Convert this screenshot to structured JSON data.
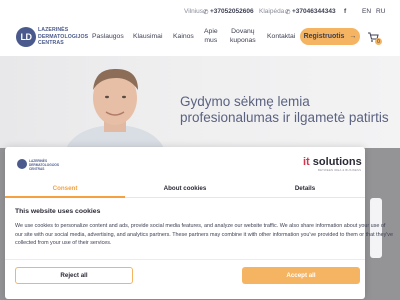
{
  "brand": {
    "logo_initials": "LD",
    "logo_text": "LAZERINĖS DERMATOLOGIJOS CENTRAS"
  },
  "topbar": {
    "city1": "Vilnius",
    "phone1": "+37052052606",
    "city2": "Klaipėda",
    "phone2": "+37046344343",
    "lang_en": "EN",
    "lang_ru": "RU"
  },
  "nav": {
    "services": "Paslaugos",
    "faq": "Klausimai",
    "prices": "Kainos",
    "about_line1": "Apie",
    "about_line2": "mus",
    "gift_line1": "Dovanų",
    "gift_line2": "kuponas",
    "contacts": "Kontaktai",
    "register": "Registruotis",
    "cart_count": "0"
  },
  "hero": {
    "title": "Gydymo sėkmę lemia profesionalumas ir ilgametė patirtis"
  },
  "cookie_dialog": {
    "brand_name": "solutions",
    "brand_prefix": "it",
    "brand_tagline": "BETWEEN IDEA & BUSINESS",
    "tabs": [
      "Consent",
      "About cookies",
      "Details"
    ],
    "active_tab": 0,
    "heading": "This website uses cookies",
    "body": "We use cookies to personalize content and ads, provide social media features, and analyze our website traffic. We also share information about your use of our site with our social media, advertising, and analytics partners. These partners may combine it with other information you've provided to them or that they've collected from your use of their services.",
    "reject_label": "Reject all",
    "accept_label": "Accept all"
  },
  "colors": {
    "accent": "#f5b462",
    "brand": "#4b5a8c",
    "text": "#3c3f52"
  }
}
